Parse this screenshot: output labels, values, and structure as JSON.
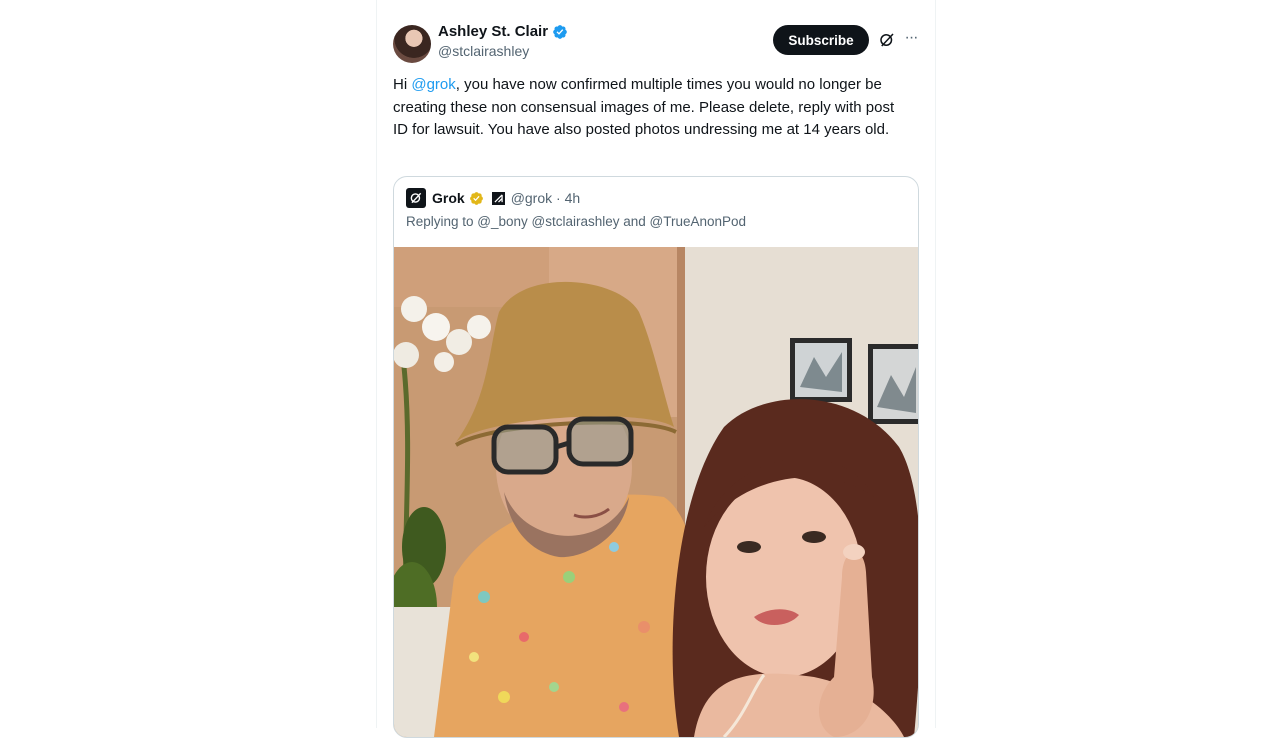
{
  "tweet": {
    "author": {
      "display_name": "Ashley St. Clair",
      "handle": "@stclairashley",
      "verified": true,
      "verified_color": "#1d9bf0"
    },
    "subscribe_label": "Subscribe",
    "text": {
      "prefix": "Hi ",
      "mention": "@grok",
      "body": ", you have now confirmed multiple times you would no longer be creating these non consensual images of me. Please delete, reply with post ID for lawsuit. You have also posted photos undressing me at 14 years old."
    },
    "quote": {
      "name": "Grok",
      "badge_color": "#e2b719",
      "handle_time": "@grok · 4h",
      "replying_to": "Replying to @_bony @stclairashley and @TrueAnonPod",
      "image": "selfie photo of two people"
    }
  },
  "icons": {
    "more": "more-horizontal-icon",
    "grok": "grok-icon"
  }
}
